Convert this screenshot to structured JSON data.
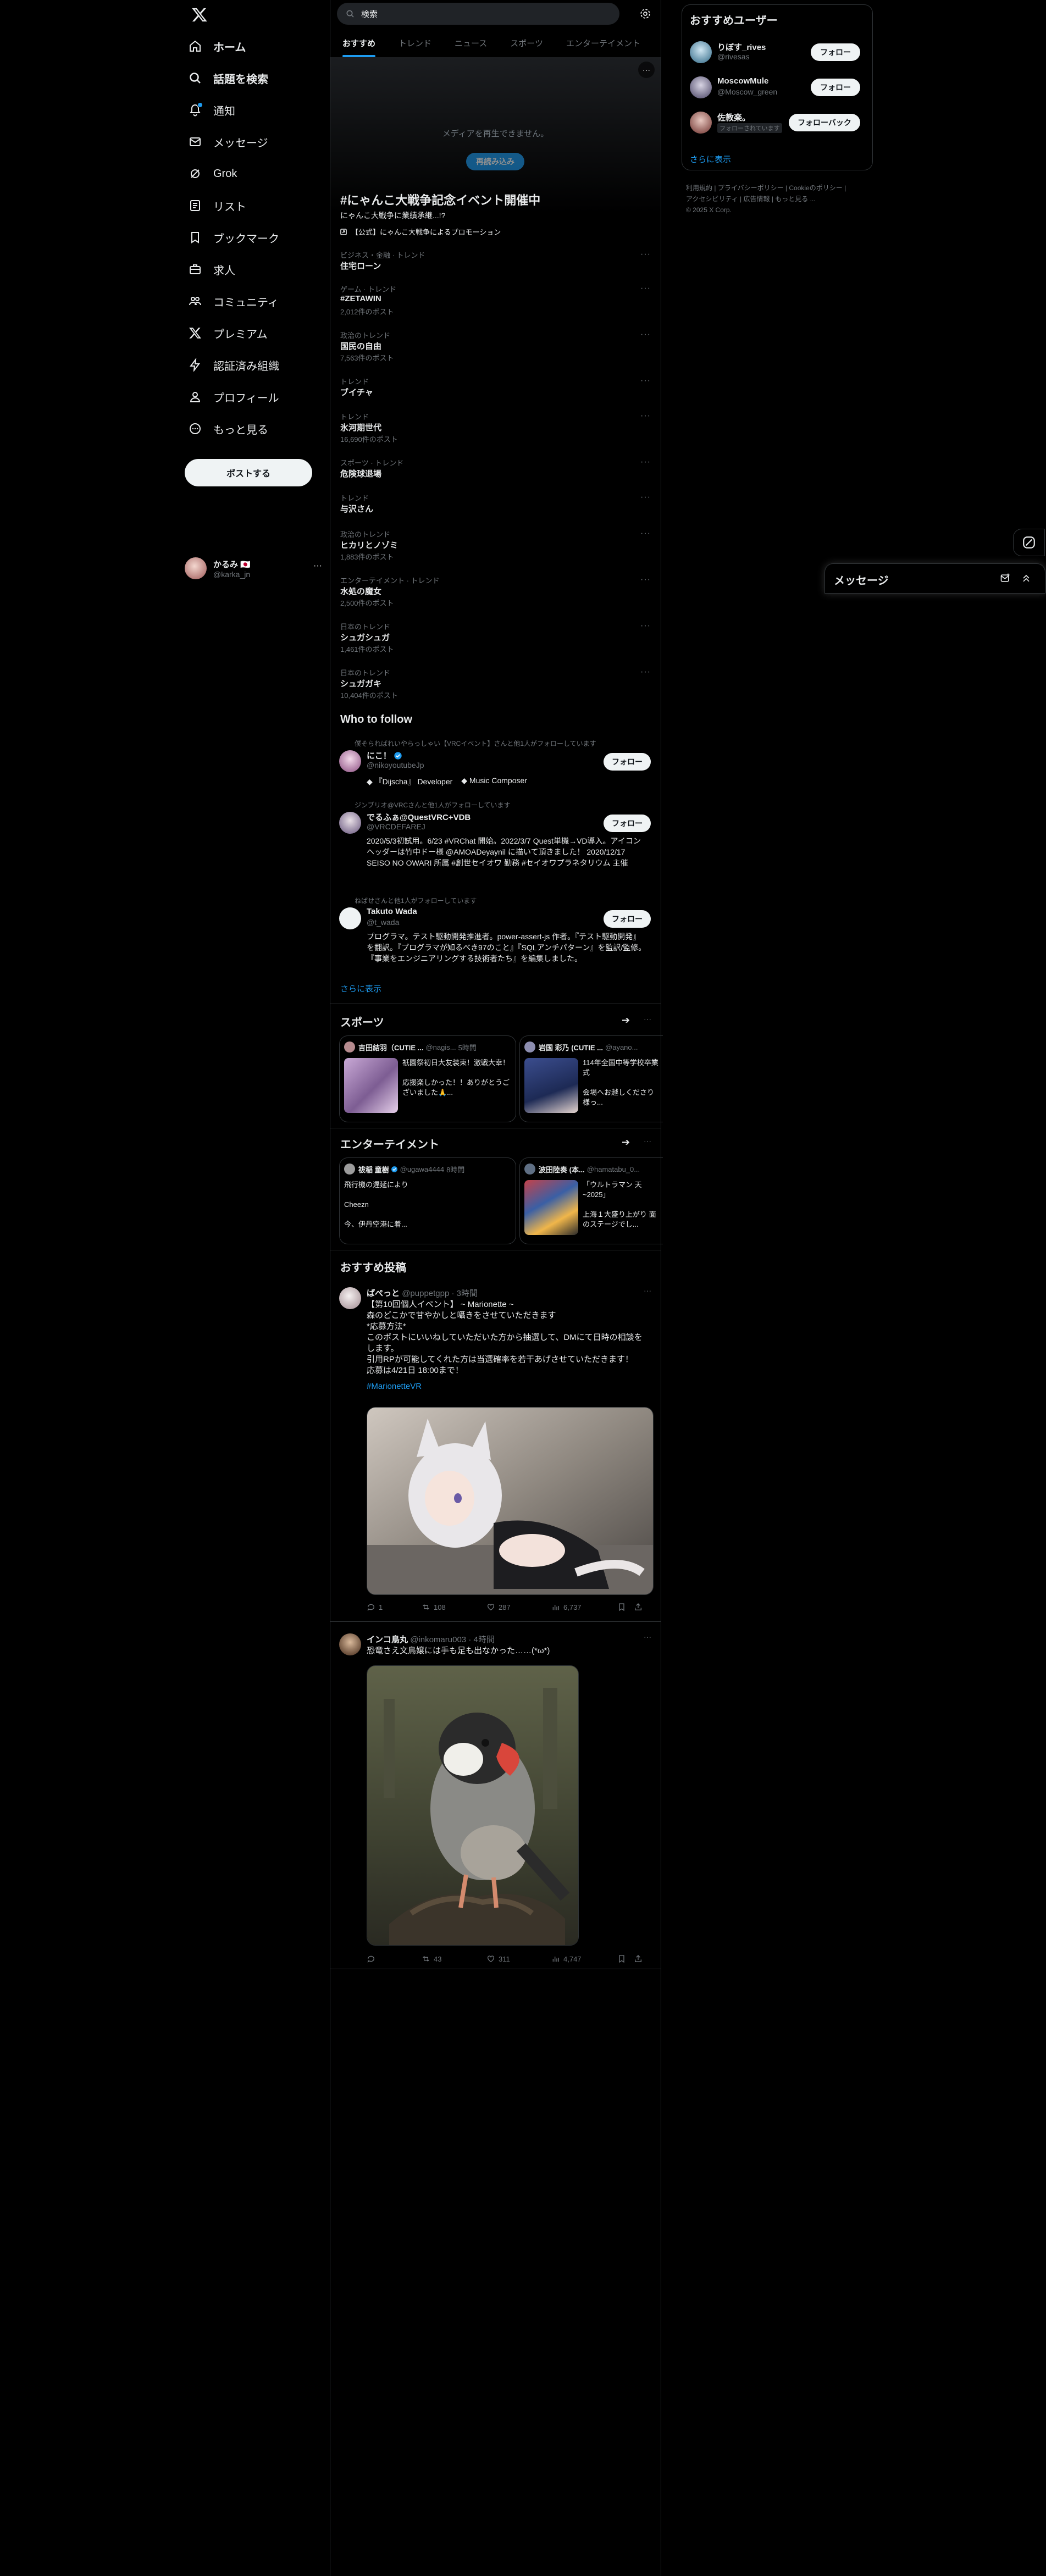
{
  "sidebar": {
    "logo": "x-logo-icon",
    "items": [
      {
        "label": "ホーム",
        "icon": "home-icon"
      },
      {
        "label": "話題を検索",
        "icon": "search-icon"
      },
      {
        "label": "通知",
        "icon": "bell-icon"
      },
      {
        "label": "メッセージ",
        "icon": "mail-icon"
      },
      {
        "label": "Grok",
        "icon": "grok-icon"
      },
      {
        "label": "リスト",
        "icon": "list-icon"
      },
      {
        "label": "ブックマーク",
        "icon": "bookmark-icon"
      },
      {
        "label": "求人",
        "icon": "briefcase-icon"
      },
      {
        "label": "コミュニティ",
        "icon": "community-icon"
      },
      {
        "label": "プレミアム",
        "icon": "x-premium-icon"
      },
      {
        "label": "認証済み組織",
        "icon": "lightning-icon"
      },
      {
        "label": "プロフィール",
        "icon": "person-icon"
      },
      {
        "label": "もっと見る",
        "icon": "more-circle-icon"
      }
    ],
    "post_button": "ポストする",
    "account": {
      "name": "かるみ",
      "flags": "🇯🇵",
      "handle": "@karka_jn",
      "more": "···"
    }
  },
  "search": {
    "value": "検索",
    "placeholder": "検索"
  },
  "tabs": [
    {
      "label": "おすすめ",
      "active": true
    },
    {
      "label": "トレンド",
      "active": false
    },
    {
      "label": "ニュース",
      "active": false
    },
    {
      "label": "スポーツ",
      "active": false
    },
    {
      "label": "エンターテイメント",
      "active": false
    }
  ],
  "hero": {
    "message": "メディアを再生できません。",
    "button": "再読み込み",
    "title": "#にゃんこ大戦争記念イベント開催中",
    "subtitle": "にゃんこ大戦争に業績承継...!?",
    "promo": "【公式】にゃんこ大戦争によるプロモーション"
  },
  "trends": [
    {
      "category": "ビジネス・金融 · トレンド",
      "name": "住宅ローン",
      "count": ""
    },
    {
      "category": "ゲーム · トレンド",
      "name": "#ZETAWIN",
      "count": "2,012件のポスト"
    },
    {
      "category": "政治のトレンド",
      "name": "国民の自由",
      "count": "7,563件のポスト"
    },
    {
      "category": "トレンド",
      "name": "ブイチャ",
      "count": ""
    },
    {
      "category": "トレンド",
      "name": "氷河期世代",
      "count": "16,690件のポスト"
    },
    {
      "category": "スポーツ · トレンド",
      "name": "危険球退場",
      "count": ""
    },
    {
      "category": "トレンド",
      "name": "与沢さん",
      "count": ""
    },
    {
      "category": "政治のトレンド",
      "name": "ヒカリとノゾミ",
      "count": "1,883件のポスト"
    },
    {
      "category": "エンターテイメント · トレンド",
      "name": "水処の魔女",
      "count": "2,500件のポスト"
    },
    {
      "category": "日本のトレンド",
      "name": "シュガシュガ",
      "count": "1,461件のポスト"
    },
    {
      "category": "日本のトレンド",
      "name": "シュガガキ",
      "count": "10,404件のポスト"
    }
  ],
  "who_to_follow": {
    "title": "Who to follow",
    "show_more": "さらに表示",
    "users": [
      {
        "context": "僕そらればれいやらっしゃい【VRCイベント】さんと他1人がフォローしています",
        "name": "にこ！",
        "verified": true,
        "handle": "@nikoyoutubeJp",
        "bio_items": [
          "『Dijscha』 Developer",
          "Music Composer"
        ],
        "button": "フォロー"
      },
      {
        "context": "ジンブリオ@VRCさんと他1人がフォローしています",
        "name": "でるふぁ@QuestVRC+VDB",
        "verified": false,
        "handle": "@VRCDEFAREJ",
        "bio": "2020/5/3初試用。6/23 #VRChat 開始。2022/3/7 Quest単機→VD導入。アイコンヘッダーは竹中ドー様 @AMOADeyaynil に描いて頂きました！ 2020/12/17 SEISO NO OWARI 所属 #創世セイオワ 勤務 #セイオワプラネタリウム 主催",
        "button": "フォロー"
      },
      {
        "context": "ねばせさんと他1人がフォローしています",
        "name": "Takuto Wada",
        "verified": false,
        "handle": "@t_wada",
        "bio": "プログラマ。テスト駆動開発推進者。power-assert-js 作者。『テスト駆動開発』を翻訳。『プログラマが知るべき97のこと』『SQLアンチパターン』を監訳/監修。『事業をエンジニアリングする技術者たち』を編集しました。",
        "button": "フォロー"
      }
    ]
  },
  "sports": {
    "title": "スポーツ",
    "cards": [
      {
        "name": "吉田結羽（CUTIE ...",
        "handle": "@nagis...",
        "time": "5時間",
        "text": "祇園祭初日大友装束！激戦大幸！\n\n応援楽しかった！！ありがとうございました🙏..."
      },
      {
        "name": "岩国 彩乃 (CUTIE ...",
        "handle": "@ayano...",
        "time": "",
        "text": "114年全国中等学校卒業式\n\n会場へお越しくださり様っ..."
      }
    ]
  },
  "entertainment": {
    "title": "エンターテイメント",
    "cards": [
      {
        "name": "祓稲 童樹",
        "handle": "@ugawa4444",
        "time": "8時間",
        "text": "飛行機の遅延により\n\nCheezn\n\n今、伊丹空港に着..."
      },
      {
        "name": "波田陸奏 (本...",
        "handle": "@hamatabu_0...",
        "time": "",
        "text": "「ウルトラマン 天 ~2025」\n\n上海１大盛り上がり 面のステージでし..."
      }
    ]
  },
  "recommended": {
    "title": "おすすめ投稿",
    "posts": [
      {
        "name": "ぱぺっと",
        "handle": "@puppetgpp",
        "time": "3時間",
        "text": "【第10回個人イベント】 ~ Marionette ~\n森のどこかで甘やかしと囁きをさせていただきます\n*応募方法*\nこのポストにいいねしていただいた方から抽選して、DMにて日時の相談をします。\n引用RPが可能してくれた方は当選確率を若干あげさせていただきます！\n応募は4/21日 18:00まで！",
        "hashtag": "#MarionetteVR",
        "image": "anime-catgirl-image",
        "stats": {
          "replies": "1",
          "reposts": "108",
          "likes": "287",
          "views": "6,737"
        }
      },
      {
        "name": "インコ鳥丸",
        "handle": "@inkomaru003",
        "time": "4時間",
        "text": "恐竜さえ文鳥嬢には手も足も出なかった……(*ω*)",
        "image": "finch-on-dinosaur-image",
        "stats": {
          "replies": "",
          "reposts": "43",
          "likes": "311",
          "views": "4,747"
        }
      }
    ]
  },
  "right": {
    "title": "おすすめユーザー",
    "users": [
      {
        "name": "りぼす_rives",
        "handle": "@rivesas",
        "button": "フォロー"
      },
      {
        "name": "MoscowMule",
        "handle": "@Moscow_green",
        "button": "フォロー"
      },
      {
        "name": "佐教楽。",
        "handle": "フォローされています",
        "button": "フォローバック"
      }
    ],
    "show_more": "さらに表示",
    "footer": [
      "利用規約",
      "プライバシーポリシー",
      "Cookieのポリシー",
      "アクセシビリティ",
      "広告情報",
      "もっと見る ...",
      "© 2025 X Corp."
    ]
  },
  "message_drawer": {
    "title": "メッセージ"
  },
  "colors": {
    "accent": "#1d9bf0",
    "bg": "#000000",
    "border": "#2f3336"
  }
}
